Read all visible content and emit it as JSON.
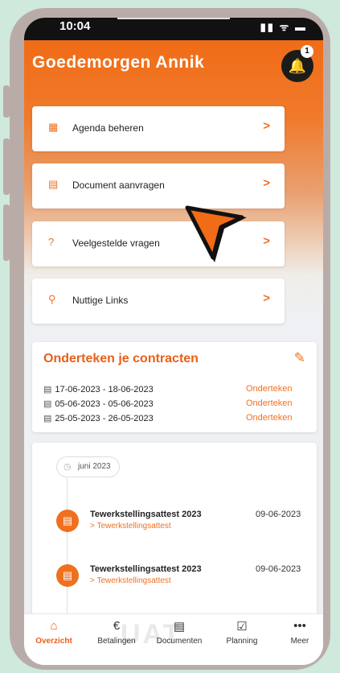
{
  "status_bar": {
    "time": "10:04",
    "icons": "▮▮ ᯤ ▬"
  },
  "header": {
    "greeting": "Goedemorgen Annik",
    "notification_count": "1",
    "bell_icon": "bell-icon"
  },
  "menu": [
    {
      "label": "Agenda beheren",
      "icon": "calendar-icon",
      "glyph": "▦"
    },
    {
      "label": "Document aanvragen",
      "icon": "document-icon",
      "glyph": "▤"
    },
    {
      "label": "Veelgestelde vragen",
      "icon": "question-icon",
      "glyph": "?"
    },
    {
      "label": "Nuttige Links",
      "icon": "link-icon",
      "glyph": "⚲"
    }
  ],
  "chevron": ">",
  "contracts": {
    "title": "Onderteken je contracten",
    "rows": [
      {
        "range": "17-06-2023 - 18-06-2023",
        "action": "Onderteken"
      },
      {
        "range": "05-06-2023 - 05-06-2023",
        "action": "Onderteken"
      },
      {
        "range": "25-05-2023 - 26-05-2023",
        "action": "Onderteken"
      }
    ]
  },
  "timeline": {
    "month": "juni 2023",
    "items": [
      {
        "title": "Tewerkstellingsattest 2023",
        "subtitle": "> Tewerkstellingsattest",
        "date": "09-06-2023"
      },
      {
        "title": "Tewerkstellingsattest 2023",
        "subtitle": "> Tewerkstellingsattest",
        "date": "09-06-2023"
      }
    ]
  },
  "tabs": [
    {
      "label": "Overzicht",
      "icon": "home-icon",
      "glyph": "⌂",
      "active": true
    },
    {
      "label": "Betalingen",
      "icon": "euro-icon",
      "glyph": "€",
      "active": false
    },
    {
      "label": "Documenten",
      "icon": "document-icon",
      "glyph": "▤",
      "active": false
    },
    {
      "label": "Planning",
      "icon": "calendar-check-icon",
      "glyph": "☑",
      "active": false
    },
    {
      "label": "Meer",
      "icon": "more-icon",
      "glyph": "•••",
      "active": false
    }
  ],
  "watermark": "UAT",
  "colors": {
    "accent": "#f07020",
    "frame": "#b9aca8",
    "background": "#cfe9dc"
  }
}
